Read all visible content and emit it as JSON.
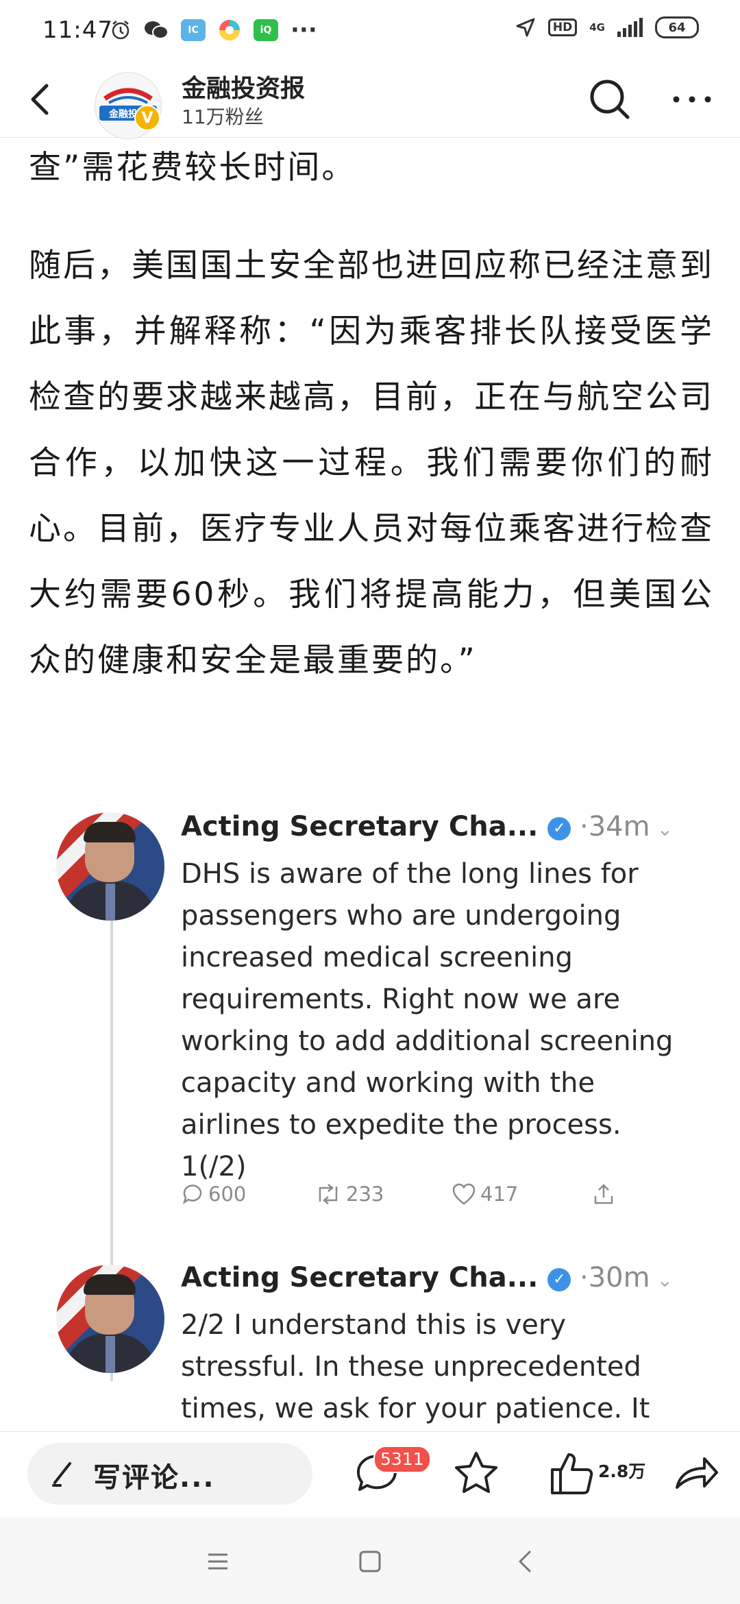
{
  "status_bar": {
    "time": "11:47",
    "left_icons": [
      "alarm-icon",
      "wechat-icon",
      "app-icon",
      "colorful-app-icon",
      "iqiyi-icon",
      "more-dots-icon"
    ],
    "hd": "HD",
    "network": "4G",
    "battery": "64"
  },
  "header": {
    "account_name": "金融投资报",
    "fans": "11万粉丝",
    "avatar_logo_text": "金融投资",
    "verified_mark": "V"
  },
  "article": {
    "para1": "查”需花费较长时间。",
    "para2": "随后，美国国土安全部也进回应称已经注意到此事，并解释称：“因为乘客排长队接受医学检查的要求越来越高，目前，正在与航空公司合作，以加快这一过程。我们需要你们的耐心。目前，医疗专业人员对每位乘客进行检查大约需要60秒。我们将提高能力，但美国公众的健康和安全是最重要的。”"
  },
  "tweets": [
    {
      "name": "Acting Secretary Cha...",
      "time": "34m",
      "text": "DHS is aware of the long lines for passengers who are undergoing increased medical screening requirements. Right now we are working to add additional screening capacity and working with the airlines to expedite the process. 1(/2)",
      "replies": "600",
      "retweets": "233",
      "likes": "417"
    },
    {
      "name": "Acting Secretary Cha...",
      "time": "30m",
      "text": "2/2 I understand this is very stressful. In these unprecedented times, we ask for your patience. It"
    }
  ],
  "action_bar": {
    "comment_placeholder": "写评论...",
    "comment_count": "5311",
    "like_count": "2.8万"
  },
  "colors": {
    "badge": "#f4504a",
    "verified": "#3d92e6",
    "vip": "#f5b400"
  }
}
